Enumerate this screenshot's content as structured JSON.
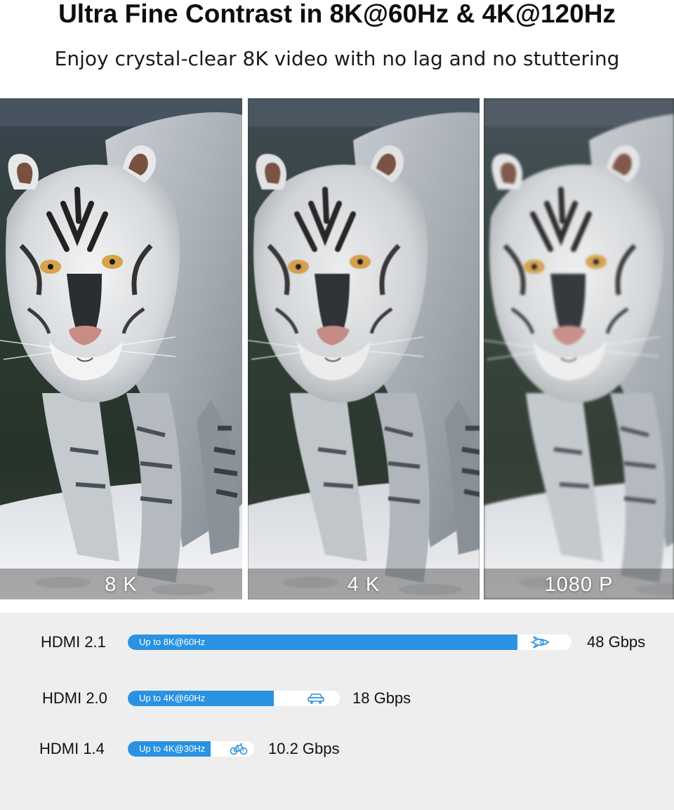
{
  "header": {
    "title": "Ultra Fine Contrast in 8K@60Hz & 4K@120Hz",
    "subtitle": "Enjoy crystal-clear 8K video with no lag and no stuttering"
  },
  "comparison_panels": [
    {
      "label": "8 K"
    },
    {
      "label": "4 K"
    },
    {
      "label": "1080 P"
    }
  ],
  "hdmi_versions": [
    {
      "name": "HDMI 2.1",
      "bar_text": "Up to 8K@60Hz",
      "bandwidth": "48 Gbps",
      "icon": "rocket-icon",
      "bar_level": 1.0
    },
    {
      "name": "HDMI 2.0",
      "bar_text": "Up to 4K@60Hz",
      "bandwidth": "18 Gbps",
      "icon": "car-icon",
      "bar_level": 0.375
    },
    {
      "name": "HDMI 1.4",
      "bar_text": "Up to 4K@30Hz",
      "bandwidth": "10.2 Gbps",
      "icon": "bicycle-icon",
      "bar_level": 0.2125
    }
  ],
  "colors": {
    "bar_fill": "#2a92e0",
    "bar_track": "#ffffff",
    "section_background": "#eeeeee",
    "icon": "#2a92e0"
  }
}
